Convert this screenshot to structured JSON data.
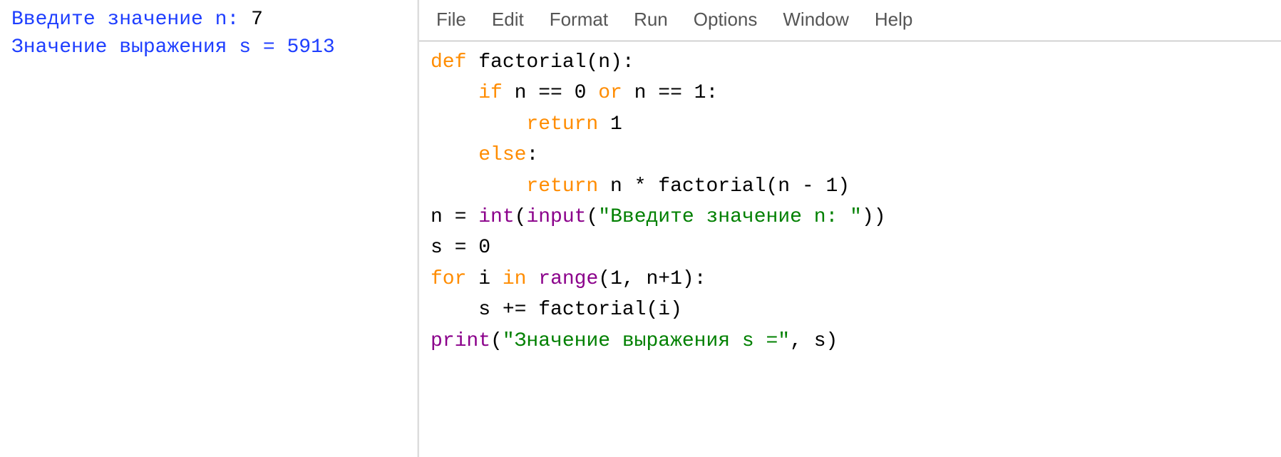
{
  "output": {
    "line1_prompt": "Введите значение n: ",
    "line1_input": "7",
    "line2_prompt": "Значение выражения s = ",
    "line2_value": "5913"
  },
  "menu": {
    "file": "File",
    "edit": "Edit",
    "format": "Format",
    "run": "Run",
    "options": "Options",
    "window": "Window",
    "help": "Help"
  },
  "code": {
    "l1_kw": "def",
    "l1_rest": " factorial(n):",
    "l2_indent": "    ",
    "l2_kw1": "if",
    "l2_mid1": " n == 0 ",
    "l2_kw2": "or",
    "l2_mid2": " n == 1:",
    "l3_indent": "        ",
    "l3_kw": "return",
    "l3_rest": " 1",
    "l4_indent": "    ",
    "l4_kw": "else",
    "l4_rest": ":",
    "l5_indent": "        ",
    "l5_kw": "return",
    "l5_rest": " n * factorial(n - 1)",
    "l6_a": "n = ",
    "l6_fn1": "int",
    "l6_b": "(",
    "l6_fn2": "input",
    "l6_c": "(",
    "l6_str": "\"Введите значение n: \"",
    "l6_d": "))",
    "l7": "s = 0",
    "l8_kw1": "for",
    "l8_mid1": " i ",
    "l8_kw2": "in",
    "l8_mid2": " ",
    "l8_fn": "range",
    "l8_rest": "(1, n+1):",
    "l9_indent": "    ",
    "l9_rest": "s += factorial(i)",
    "l10_fn": "print",
    "l10_a": "(",
    "l10_str": "\"Значение выражения s =\"",
    "l10_b": ", s)"
  }
}
